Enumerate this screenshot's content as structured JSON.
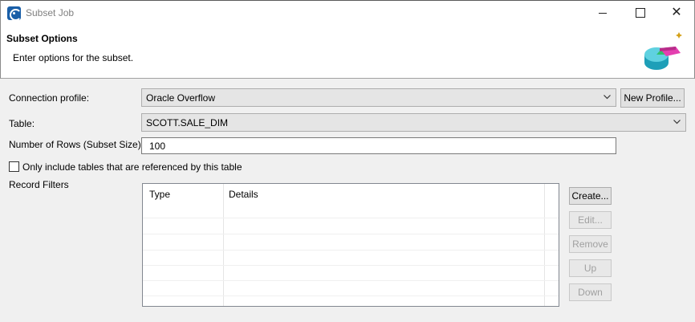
{
  "window": {
    "title": "Subset Job",
    "close_glyph": "✕"
  },
  "header": {
    "title": "Subset Options",
    "description": "Enter options for the subset."
  },
  "form": {
    "connection_profile_label": "Connection profile:",
    "connection_profile_value": "Oracle Overflow",
    "new_profile_button": "New Profile...",
    "table_label": "Table:",
    "table_value": "SCOTT.SALE_DIM",
    "rows_label": "Number of Rows (Subset Size):",
    "rows_value": "100",
    "only_referenced_label": "Only include tables that are referenced by this table",
    "only_referenced_checked": false,
    "record_filters_label": "Record Filters"
  },
  "record_filters": {
    "columns": [
      "Type",
      "Details"
    ],
    "rows": []
  },
  "filter_buttons": {
    "create": "Create...",
    "edit": "Edit...",
    "remove": "Remove",
    "up": "Up",
    "down": "Down"
  },
  "colors": {
    "accent": "#1a5fa8",
    "window_bg": "#f0f0f0",
    "disabled_text": "#a0a0a0"
  },
  "icons": {
    "app": "subset-job-app-icon",
    "header_logo": "pie-chart-database-icon",
    "combo_arrow": "chevron-down-icon"
  }
}
